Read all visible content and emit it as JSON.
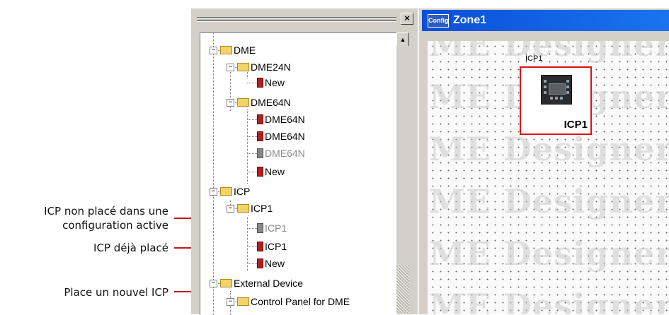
{
  "callouts": {
    "not_placed_line1": "ICP non placé dans une",
    "not_placed_line2": "configuration active",
    "already_placed": "ICP déjà placé",
    "place_new": "Place un nouvel ICP"
  },
  "tree_panel": {
    "close_label": "×",
    "items": [
      {
        "label": "DME",
        "type": "folder",
        "expanded": true
      },
      {
        "label": "DME24N",
        "type": "folder",
        "expanded": true
      },
      {
        "label": "New",
        "type": "device"
      },
      {
        "label": "DME64N",
        "type": "folder",
        "expanded": true
      },
      {
        "label": "DME64N",
        "type": "device"
      },
      {
        "label": "DME64N",
        "type": "device"
      },
      {
        "label": "DME64N",
        "type": "device",
        "inactive": true
      },
      {
        "label": "New",
        "type": "device"
      },
      {
        "label": "ICP",
        "type": "folder",
        "expanded": true
      },
      {
        "label": "ICP1",
        "type": "folder",
        "expanded": true
      },
      {
        "label": "ICP1",
        "type": "device",
        "inactive": true
      },
      {
        "label": "ICP1",
        "type": "device"
      },
      {
        "label": "New",
        "type": "device"
      },
      {
        "label": "External Device",
        "type": "folder",
        "expanded": true
      },
      {
        "label": "Control Panel for DME",
        "type": "folder",
        "expanded": true
      }
    ]
  },
  "zone_window": {
    "icon_label": "Config",
    "title": "Zone1",
    "watermark": "ME Designer",
    "component": {
      "top_label": "ICP1",
      "name": "ICP1"
    }
  },
  "colors": {
    "titlebar": "#0a4fd8",
    "callout_line": "#c01818",
    "highlight_border": "#e01010"
  }
}
